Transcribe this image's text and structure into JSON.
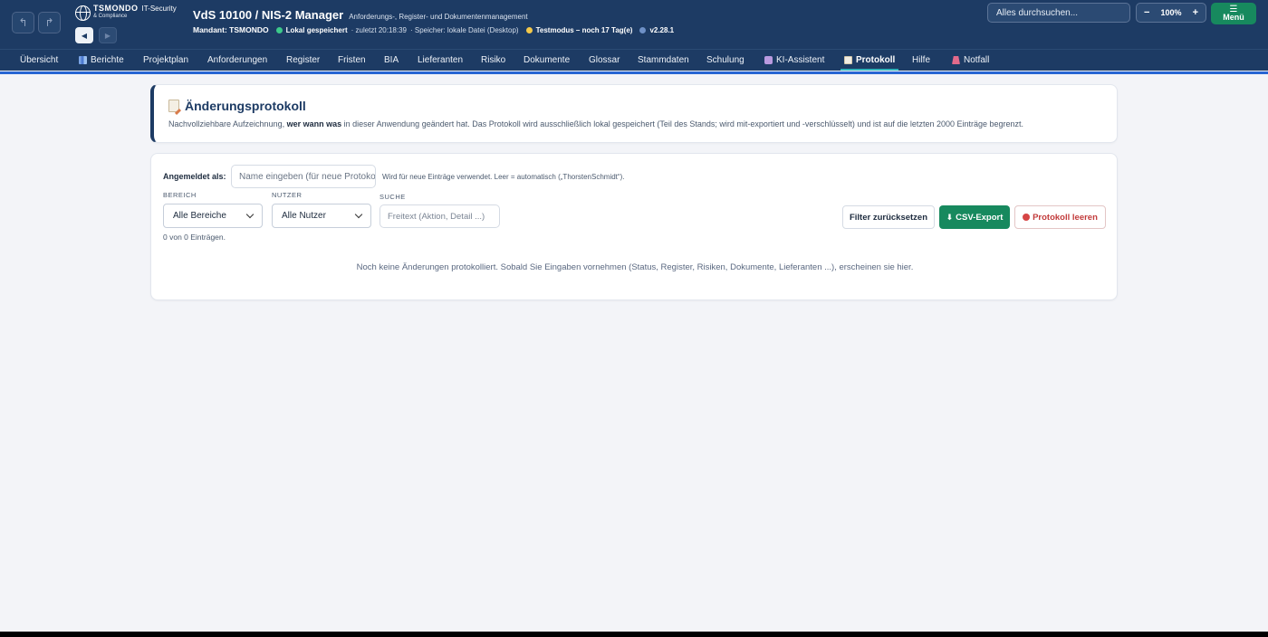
{
  "header": {
    "logo": {
      "name": "TSMONDO",
      "name_suffix": "IT-Security",
      "sub": "& Compliance"
    },
    "undo_icon": "↰",
    "redo_icon": "↱",
    "back_icon": "◀",
    "forward_icon": "▶",
    "title": "VdS 10100 / NIS-2 Manager",
    "subtitle": "Anforderungs-, Register- und Dokumentenmanagement",
    "mandant": "Mandant: TSMONDO",
    "save_status": "Lokal gespeichert",
    "save_time": "· zuletzt 20:18:39",
    "storage": "· Speicher: lokale Datei (Desktop)",
    "test_mode": "Testmodus – noch 17 Tag(e)",
    "version": "v2.28.1",
    "search_placeholder": "Alles durchsuchen...",
    "zoom": {
      "minus": "−",
      "level": "100%",
      "plus": "+"
    },
    "menu": {
      "icon": "☰",
      "label": "Menü"
    }
  },
  "tabs": [
    {
      "label": "Übersicht"
    },
    {
      "label": "Berichte",
      "icon": "bar-chart-icon"
    },
    {
      "label": "Projektplan"
    },
    {
      "label": "Anforderungen"
    },
    {
      "label": "Register"
    },
    {
      "label": "Fristen"
    },
    {
      "label": "BIA"
    },
    {
      "label": "Lieferanten"
    },
    {
      "label": "Risiko"
    },
    {
      "label": "Dokumente"
    },
    {
      "label": "Glossar"
    },
    {
      "label": "Stammdaten"
    },
    {
      "label": "Schulung"
    },
    {
      "label": "KI-Assistent",
      "icon": "robot-icon"
    },
    {
      "label": "Protokoll",
      "icon": "document-icon",
      "active": true
    },
    {
      "label": "Hilfe"
    },
    {
      "label": "Notfall",
      "icon": "alarm-icon"
    }
  ],
  "info": {
    "title": "Änderungsprotokoll",
    "desc_pre": "Nachvollziehbare Aufzeichnung, ",
    "desc_bold": "wer wann was",
    "desc_post": " in dieser Anwendung geändert hat. Das Protokoll wird ausschließlich lokal gespeichert (Teil des Stands; wird mit-exportiert und -verschlüsselt) und ist auf die letzten 2000 Einträge begrenzt."
  },
  "filters": {
    "login_label": "Angemeldet als:",
    "login_placeholder": "Name eingeben (für neue Protokolleinträge)",
    "login_hint": "Wird für neue Einträge verwendet. Leer = automatisch („ThorstenSchmidt“).",
    "bereich_label": "BEREICH",
    "bereich_value": "Alle Bereiche",
    "nutzer_label": "NUTZER",
    "nutzer_value": "Alle Nutzer",
    "suche_label": "SUCHE",
    "suche_placeholder": "Freitext (Aktion, Detail ...)",
    "reset_label": "Filter zurücksetzen",
    "csv_icon": "⬇",
    "csv_label": "CSV-Export",
    "clear_label": "Protokoll leeren",
    "count": "0 von 0 Einträgen.",
    "empty": "Noch keine Änderungen protokolliert. Sobald Sie Eingaben vornehmen (Status, Register, Risiken, Dokumente, Lieferanten ...), erscheinen sie hier."
  },
  "colors": {
    "header_bg": "#1d3b64",
    "accent_green": "#17895e",
    "danger": "#c23b3b",
    "active_tab_underline": "#2fb3ba"
  }
}
